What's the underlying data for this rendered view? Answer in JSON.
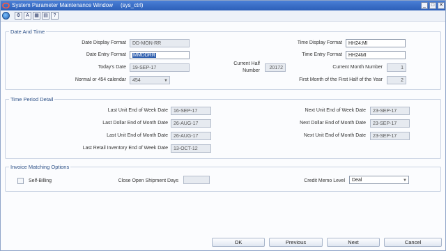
{
  "window": {
    "title": "System Parameter Maintenance Window",
    "subtitle": "(sys_ctrl)",
    "controls": {
      "minimize": "_",
      "maximize": "□",
      "close": "✕"
    }
  },
  "toolbar": {
    "icons": [
      "globe-icon",
      "tools-icon",
      "text-icon",
      "grid-icon",
      "print-icon",
      "help-icon"
    ],
    "glyphs": {
      "tools": "⚙",
      "text": "A",
      "grid": "▦",
      "print": "▤",
      "help": "?"
    }
  },
  "date_and_time": {
    "heading": "Date And Time",
    "date_display_format": {
      "label": "Date Display Format",
      "value": "DD-MON-RR"
    },
    "date_entry_format": {
      "label": "Date Entry Format",
      "value": "MMDDRR"
    },
    "todays_date": {
      "label": "Today's Date",
      "value": "19-SEP-17"
    },
    "calendar": {
      "label": "Normal or 454 calendar",
      "value": "454"
    },
    "current_half": {
      "label_line1": "Current Half",
      "label_line2": "Number",
      "value": "20172"
    },
    "time_display_format": {
      "label": "Time Display Format",
      "value": "HH24:MI"
    },
    "time_entry_format": {
      "label": "Time Entry Format",
      "value": "HH24MI"
    },
    "current_month_number": {
      "label": "Current Month Number",
      "value": "1"
    },
    "first_month_first_half": {
      "label": "First Month of the First Half of the Year",
      "value": "2"
    }
  },
  "time_period_detail": {
    "heading": "Time Period Detail",
    "last_unit_eow": {
      "label": "Last Unit End of Week Date",
      "value": "16-SEP-17"
    },
    "last_dollar_eom": {
      "label": "Last Dollar End of Month Date",
      "value": "26-AUG-17"
    },
    "last_unit_eom": {
      "label": "Last Unit End of Month Date",
      "value": "26-AUG-17"
    },
    "last_retail_inv_eow": {
      "label": "Last Retail Inventory End of Week Date",
      "value": "13-OCT-12"
    },
    "next_unit_eow": {
      "label": "Next Unit End of Week Date",
      "value": "23-SEP-17"
    },
    "next_dollar_eom": {
      "label": "Next Dollar End of Month Date",
      "value": "23-SEP-17"
    },
    "next_unit_eom": {
      "label": "Next Unit End of Month Date",
      "value": "23-SEP-17"
    }
  },
  "invoice_matching": {
    "heading": "Invoice Matching Options",
    "self_billing": {
      "label": "Self-Billing",
      "checked": false
    },
    "close_open_shipment_days": {
      "label": "Close Open Shipment Days",
      "value": ""
    },
    "credit_memo_level": {
      "label": "Credit Memo Level",
      "value": "Deal"
    }
  },
  "buttons": {
    "ok": "OK",
    "previous": "Previous",
    "next": "Next",
    "cancel": "Cancel"
  }
}
